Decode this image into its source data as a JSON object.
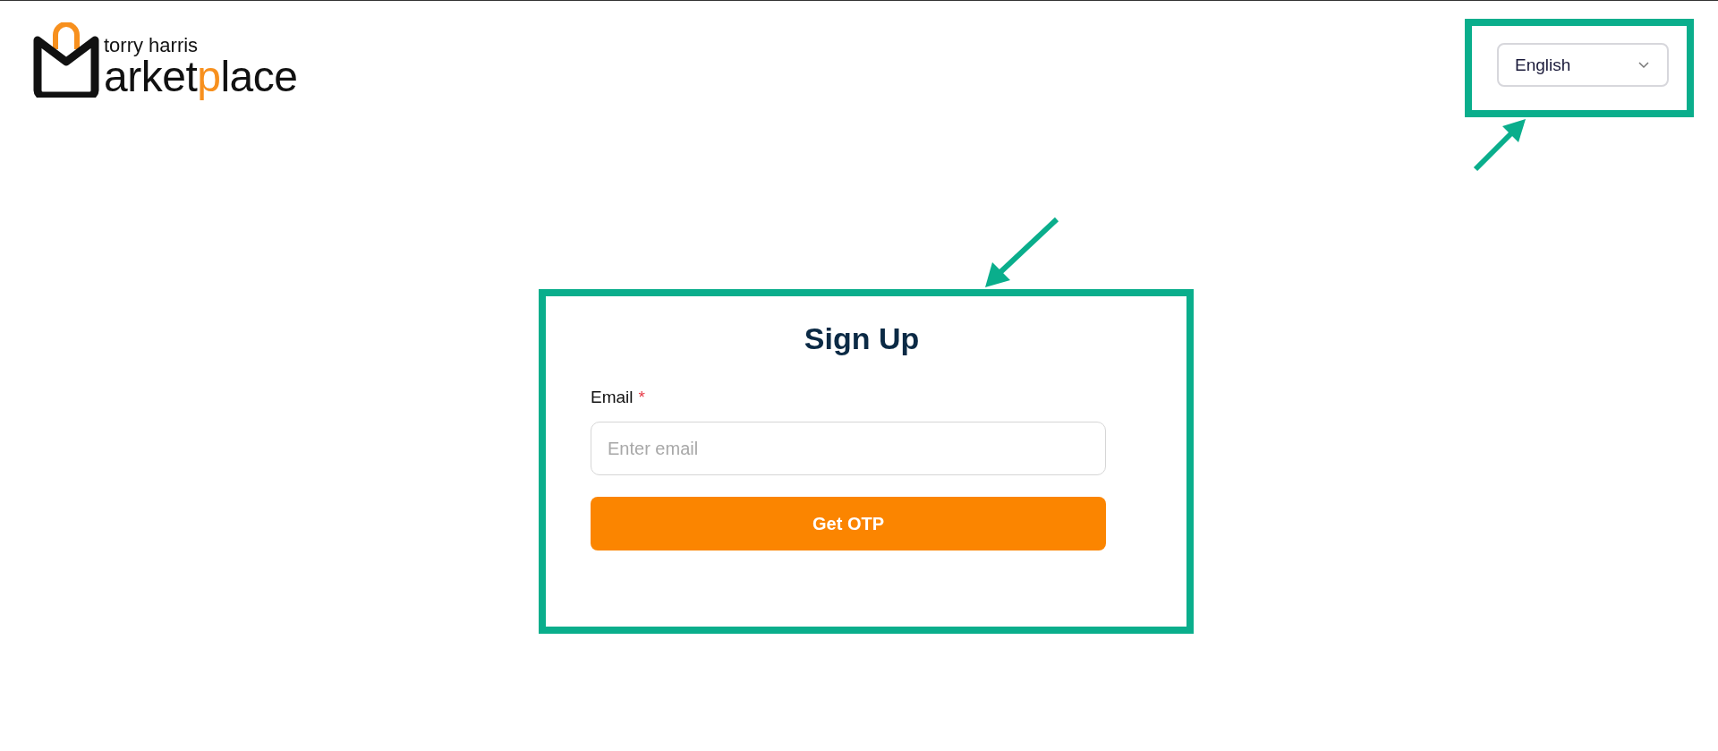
{
  "logo": {
    "tagline": "torry harris",
    "wordmark": [
      {
        "text": "arket",
        "accent": false
      },
      {
        "text": "p",
        "accent": true
      },
      {
        "text": "lace",
        "accent": false
      }
    ]
  },
  "language_select": {
    "value": "English"
  },
  "signup": {
    "title": "Sign Up",
    "email_label": "Email",
    "required_mark": "*",
    "email_placeholder": "Enter email",
    "button": "Get OTP"
  }
}
